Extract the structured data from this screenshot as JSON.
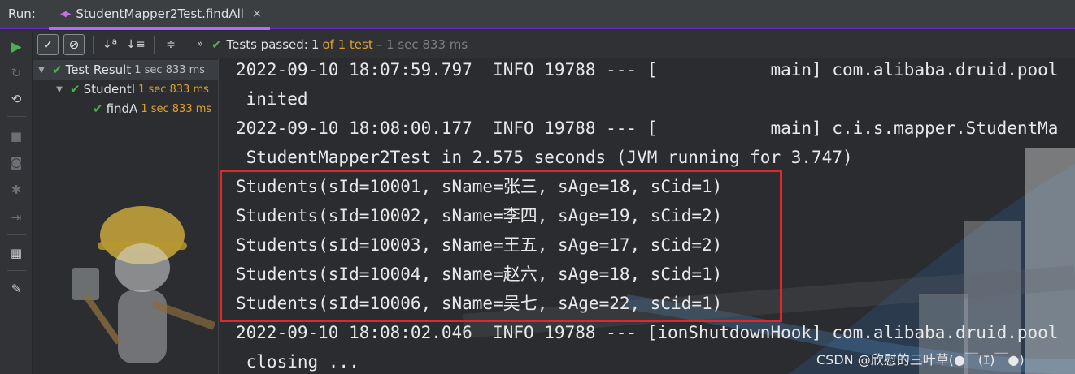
{
  "topbar": {
    "run_label": "Run:",
    "tab_title": "StudentMapper2Test.findAll",
    "close_glyph": "×"
  },
  "left_toolbar": {
    "icons": [
      "play-icon",
      "rerun-failed-icon",
      "toggle-auto-test-icon",
      "stop-icon",
      "camera-icon",
      "settings-icon",
      "import-icon",
      "layout-icon",
      "pin-icon"
    ]
  },
  "toolbar": {
    "show_passed_glyph": "✓",
    "show_ignored_glyph": "⊘",
    "sort_alpha_glyph": "↓ª",
    "sort_duration_glyph": "↓≡",
    "collapse_glyph": "≑",
    "more_glyph": "»",
    "status": {
      "check": "✔",
      "passed_label": "Tests passed:",
      "count": "1",
      "of_text": "of 1 test",
      "duration": "– 1 sec 833 ms"
    }
  },
  "tree": {
    "items": [
      {
        "label": "Test Result",
        "time": "1 sec 833 ms"
      },
      {
        "label": "StudentI",
        "time": "1 sec 833 ms"
      },
      {
        "label": "findA",
        "time": "1 sec 833 ms"
      }
    ]
  },
  "console": {
    "lines": [
      "2022-09-10 18:07:59.797  INFO 19788 --- [           main] com.alibaba.druid.pool",
      " inited",
      "2022-09-10 18:08:00.177  INFO 19788 --- [           main] c.i.s.mapper.StudentMa",
      " StudentMapper2Test in 2.575 seconds (JVM running for 3.747)",
      "Students(sId=10001, sName=张三, sAge=18, sCid=1)",
      "Students(sId=10002, sName=李四, sAge=19, sCid=2)",
      "Students(sId=10003, sName=王五, sAge=17, sCid=2)",
      "Students(sId=10004, sName=赵六, sAge=18, sCid=1)",
      "Students(sId=10006, sName=吴七, sAge=22, sCid=1)",
      "2022-09-10 18:08:02.046  INFO 19788 --- [ionShutdownHook] com.alibaba.druid.pool",
      " closing ..."
    ]
  },
  "watermark": "CSDN @欣慰的三叶草(●￣(ｴ)￣●)",
  "colors": {
    "accent": "#b06cff",
    "success": "#4caf50",
    "warning": "#e0a030",
    "highlight": "#e0282c"
  }
}
